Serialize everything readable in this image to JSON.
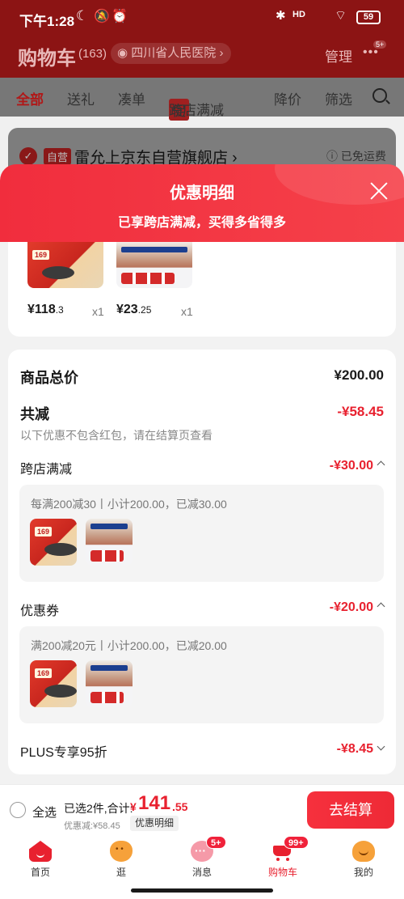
{
  "status_bar": {
    "time": "下午1:28",
    "battery": "59",
    "signal": "HD"
  },
  "header": {
    "title": "购物车",
    "count": "(163)",
    "location": "四川省人民医院",
    "manage_label": "管理",
    "more_badge": "5+"
  },
  "filters": [
    {
      "label": "全部",
      "active": true
    },
    {
      "label": "送礼"
    },
    {
      "label": "凑单"
    },
    {
      "label": "跨店满减",
      "tag": "促"
    },
    {
      "label": "降价"
    },
    {
      "label": "筛选"
    }
  ],
  "store": {
    "self_tag": "自营",
    "name": "雷允上京东自营旗舰店",
    "shipping": "已免运费"
  },
  "sheet": {
    "title": "优惠明细",
    "subtitle": "已享跨店满减，买得多省得多"
  },
  "products": [
    {
      "price_int": "¥118",
      "price_dec": ".3",
      "qty": "x1"
    },
    {
      "price_int": "¥23",
      "price_dec": ".25",
      "qty": "x1"
    }
  ],
  "detail": {
    "total_label": "商品总价",
    "total_value": "¥200.00",
    "reduce_label": "共减",
    "reduce_value": "-¥58.45",
    "note": "以下优惠不包含红包，请在结算页查看",
    "cross_store": {
      "label": "跨店满减",
      "value": "-¥30.00",
      "desc": "每满200减30丨小计200.00，已减30.00"
    },
    "coupon": {
      "label": "优惠券",
      "value": "-¥20.00",
      "desc": "满200减20元丨小计200.00，已减20.00"
    },
    "plus": {
      "label": "PLUS专享95折",
      "value": "-¥8.45"
    }
  },
  "checkout": {
    "select_all": "全选",
    "selected_text": "已选2件,合计:",
    "yen": "¥",
    "total_int": "141",
    "total_dec": ".55",
    "discount_text": "优惠减:¥58.45",
    "discount_btn": "优惠明细",
    "button": "去结算"
  },
  "tabbar": [
    {
      "label": "首页",
      "icon": "home-icon"
    },
    {
      "label": "逛",
      "icon": "browse-icon"
    },
    {
      "label": "消息",
      "icon": "message-icon",
      "badge": "5+"
    },
    {
      "label": "购物车",
      "icon": "cart-icon",
      "badge": "99+",
      "active": true
    },
    {
      "label": "我的",
      "icon": "profile-icon"
    }
  ],
  "colors": {
    "accent": "#e8212f",
    "header_dim": "#8c1414"
  }
}
